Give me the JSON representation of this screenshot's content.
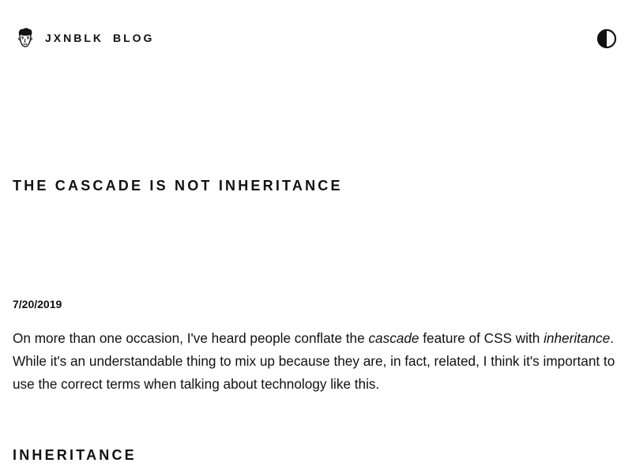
{
  "nav": {
    "brand": "JXNBLK",
    "blog": "BLOG"
  },
  "icons": {
    "logo": "face-avatar-icon",
    "theme_toggle": "contrast-icon"
  },
  "post": {
    "title": "THE CASCADE IS NOT INHERITANCE",
    "date": "7/20/2019",
    "intro": {
      "part1": "On more than one occasion, I've heard people conflate the ",
      "em1": "cascade",
      "part2": " feature of CSS with ",
      "em2": "inheritance",
      "part3": ". While it's an understandable thing to mix up because they are, in fact, related, I think it's important to use the correct terms when talking about technology like this."
    },
    "section_heading": "INHERITANCE"
  },
  "colors": {
    "text": "#111111",
    "background": "#ffffff"
  }
}
